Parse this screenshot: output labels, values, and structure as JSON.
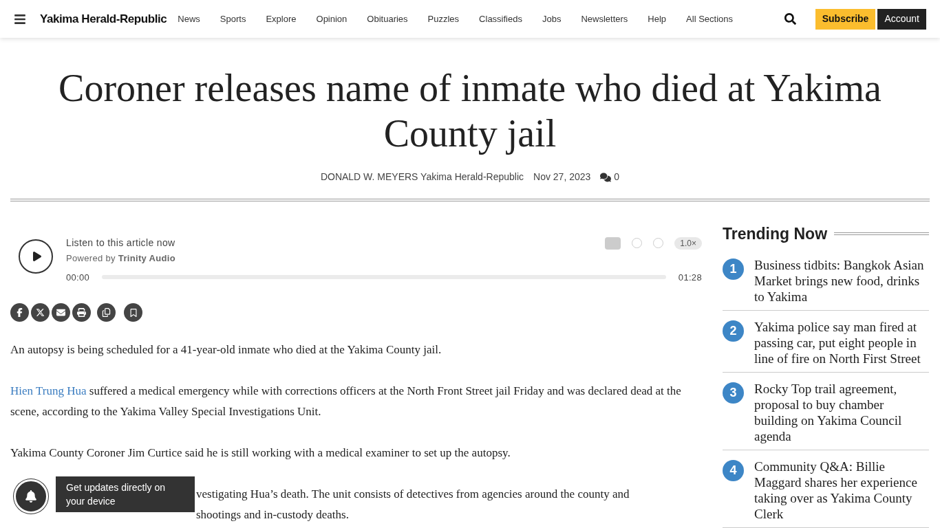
{
  "header": {
    "logo": "Yakima Herald-Republic",
    "nav": [
      "News",
      "Sports",
      "Explore",
      "Opinion",
      "Obituaries",
      "Puzzles",
      "Classifieds",
      "Jobs",
      "Newsletters",
      "Help",
      "All Sections"
    ],
    "subscribe": "Subscribe",
    "account": "Account"
  },
  "article": {
    "title": "Coroner releases name of inmate who died at Yakima County jail",
    "author": "DONALD W. MEYERS",
    "source": "Yakima Herald-Republic",
    "date": "Nov 27, 2023",
    "comments": "0"
  },
  "audio": {
    "title": "Listen to this article now",
    "powered": "Powered by **Trinity Audio**",
    "current": "00:00",
    "duration": "01:28",
    "speed": "1.0×"
  },
  "body": [
    {
      "kind": "plain",
      "text": "An autopsy is being scheduled for a 41-year-old inmate who died at the Yakima County jail."
    },
    {
      "kind": "link",
      "link": "Hien Trung Hua",
      "text": " suffered a medical emergency while with corrections officers at the North Front Street jail Friday and was declared dead at the scene, according to the Yakima Valley Special Investigations Unit."
    },
    {
      "kind": "plain",
      "text": "Yakima County Coroner Jim Curtice said he is still working with a medical examiner to set up the autopsy."
    },
    {
      "kind": "covered",
      "lines": [
        "vestigating Hua’s death. The unit consists of detectives from agencies around the county and",
        "shootings and in-custody deaths."
      ]
    }
  ],
  "notification": {
    "text": "Get updates directly on your device"
  },
  "trending": {
    "title": "Trending Now",
    "items": [
      {
        "number": "1",
        "text": "Business tidbits: Bangkok Asian Market brings new food, drinks to Yakima"
      },
      {
        "number": "2",
        "text": "Yakima police say man fired at passing car, put eight people in line of fire on North First Street"
      },
      {
        "number": "3",
        "text": "Rocky Top trail agreement, proposal to buy chamber building on Yakima Council agenda"
      },
      {
        "number": "4",
        "text": "Community Q&A: Billie Maggard shares her experience taking over as Yakima County Clerk"
      }
    ]
  }
}
